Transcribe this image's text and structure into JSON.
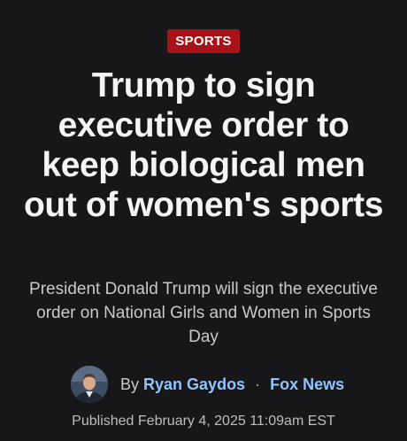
{
  "article": {
    "category": "SPORTS",
    "headline": "Trump to sign executive order to keep biological men out of women's sports",
    "subhead": "President Donald Trump will sign the executive order on National Girls and Women in Sports Day",
    "byline": {
      "prefix": "By",
      "author": "Ryan Gaydos",
      "separator": "·",
      "publisher": "Fox News"
    },
    "published": "Published February 4, 2025 11:09am EST"
  },
  "colors": {
    "background": "#17171a",
    "badge": "#a8131a",
    "link": "#8fc4ff",
    "headline": "#f4f4f4",
    "subhead": "#c9c9cc"
  },
  "icons": {
    "avatar": "author-avatar-photo"
  }
}
